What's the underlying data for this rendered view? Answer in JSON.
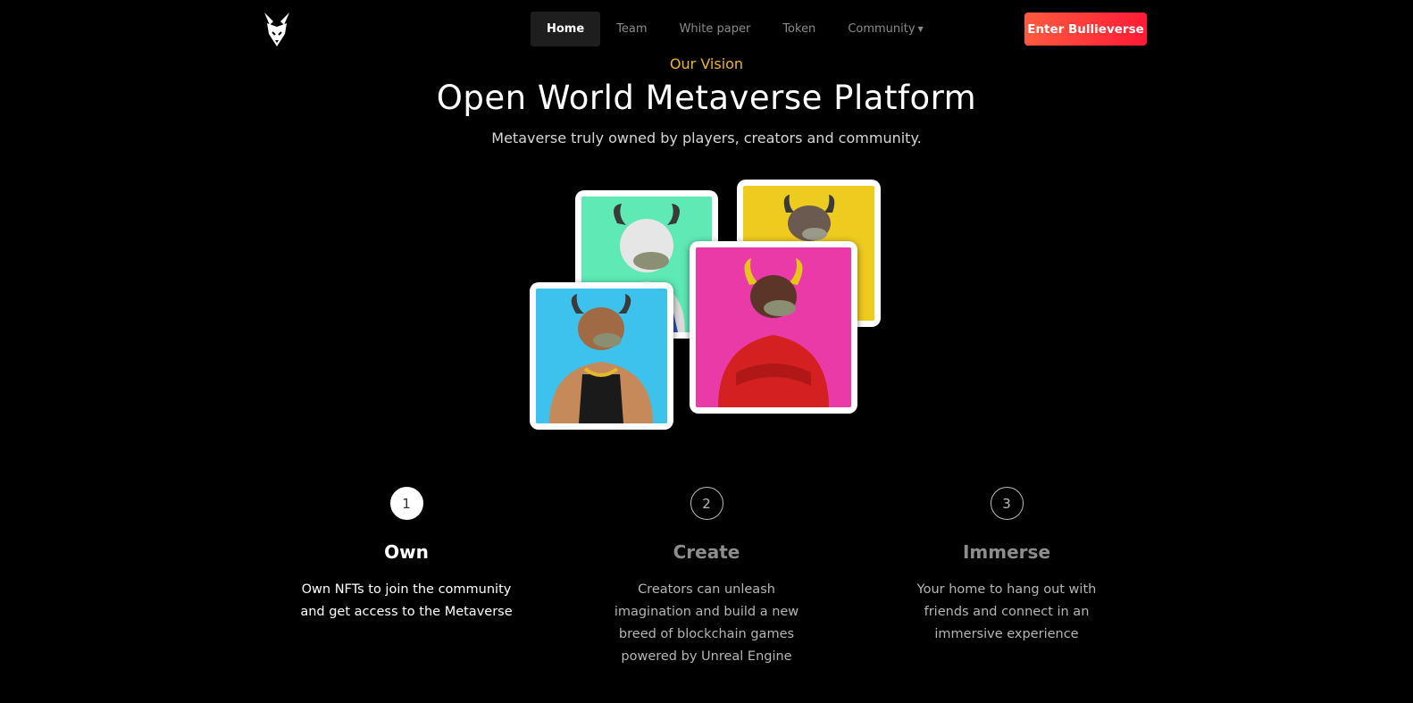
{
  "brand": {
    "logo_icon": "bull-head-icon"
  },
  "nav": {
    "items": [
      {
        "label": "Home",
        "active": true
      },
      {
        "label": "Team",
        "active": false
      },
      {
        "label": "White paper",
        "active": false
      },
      {
        "label": "Token",
        "active": false
      },
      {
        "label": "Community",
        "active": false,
        "dropdown": true
      }
    ],
    "cta_label": "Enter Bullieverse"
  },
  "hero": {
    "eyebrow": "Our Vision",
    "title": "Open World Metaverse Platform",
    "subtitle": "Metaverse truly owned by players, creators and community."
  },
  "cards": [
    {
      "name": "bull-card-mint",
      "bg": "#5ee9b5"
    },
    {
      "name": "bull-card-yellow",
      "bg": "#eecb1f"
    },
    {
      "name": "bull-card-magenta",
      "bg": "#e93aa8"
    },
    {
      "name": "bull-card-cyan",
      "bg": "#3cc2ec"
    }
  ],
  "steps": [
    {
      "number": "1",
      "title": "Own",
      "desc": "Own NFTs to join the community and get access to the Metaverse",
      "active": true
    },
    {
      "number": "2",
      "title": "Create",
      "desc": "Creators can unleash imagination and build a new breed of blockchain games powered by Unreal Engine",
      "active": false
    },
    {
      "number": "3",
      "title": "Immerse",
      "desc": "Your home to hang out with friends and connect in an immersive experience",
      "active": false
    }
  ],
  "colors": {
    "accent": "#f2b51c",
    "cta_start": "#ff5a3f",
    "cta_end": "#ff1a35",
    "background": "#000000"
  }
}
